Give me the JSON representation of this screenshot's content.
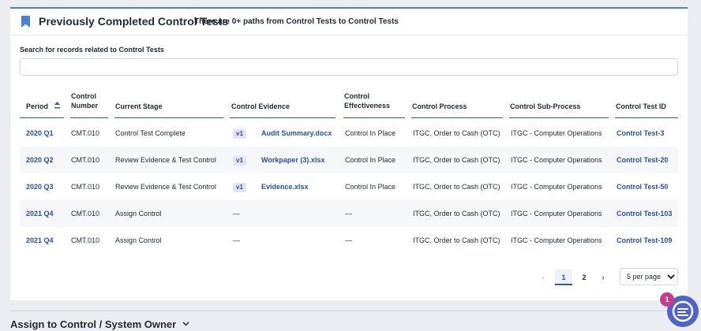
{
  "section": {
    "title": "Previously Completed Control Tests",
    "subtitle": "There are 0+ paths from Control Tests to Control Tests",
    "search_label": "Search for records related to Control Tests",
    "search_value": ""
  },
  "table": {
    "columns": {
      "period": "Period",
      "control_number_1": "Control",
      "control_number_2": "Number",
      "current_stage": "Current Stage",
      "control_evidence": "Control Evidence",
      "control_effectiveness_1": "Control",
      "control_effectiveness_2": "Effectiveness",
      "control_process": "Control Process",
      "control_sub_process": "Control Sub-Process",
      "control_test_id": "Control Test ID"
    },
    "rows": [
      {
        "period": "2020 Q1",
        "number": "CMT.010",
        "stage": "Control Test Complete",
        "version": "v1",
        "evidence": "Audit Summary.docx",
        "effectiveness": "Control In Place",
        "process": "ITGC, Order to Cash (OTC)",
        "sub_process": "ITGC - Computer Operations",
        "test_id": "Control Test-3"
      },
      {
        "period": "2020 Q2",
        "number": "CMT.010",
        "stage": "Review Evidence & Test Control",
        "version": "v1",
        "evidence": "Workpaper (3).xlsx",
        "effectiveness": "Control In Place",
        "process": "ITGC, Order to Cash (OTC)",
        "sub_process": "ITGC - Computer Operations",
        "test_id": "Control Test-20"
      },
      {
        "period": "2020 Q3",
        "number": "CMT.010",
        "stage": "Review Evidence & Test Control",
        "version": "v1",
        "evidence": "Evidence.xlsx",
        "effectiveness": "Control In Place",
        "process": "ITGC, Order to Cash (OTC)",
        "sub_process": "ITGC - Computer Operations",
        "test_id": "Control Test-50"
      },
      {
        "period": "2021 Q4",
        "number": "CMT.010",
        "stage": "Assign Control",
        "version": "",
        "evidence": "—",
        "effectiveness": "—",
        "process": "ITGC, Order to Cash (OTC)",
        "sub_process": "ITGC - Computer Operations",
        "test_id": "Control Test-103"
      },
      {
        "period": "2021 Q4",
        "number": "CMT.010",
        "stage": "Assign Control",
        "version": "",
        "evidence": "—",
        "effectiveness": "—",
        "process": "ITGC, Order to Cash (OTC)",
        "sub_process": "ITGC - Computer Operations",
        "test_id": "Control Test-109"
      }
    ]
  },
  "pagination": {
    "prev": "‹",
    "page_1": "1",
    "page_2": "2",
    "next": "›",
    "per_page": "5 per page",
    "per_page_options": [
      "5 per page"
    ]
  },
  "next_section": {
    "title": "Assign to Control / System Owner"
  },
  "chat": {
    "badge_count": "1"
  },
  "colors": {
    "accent": "#4a7fd4",
    "link": "#2a4fa8",
    "chat": "#4f63c8",
    "badge": "#c73c8f"
  },
  "icons": {
    "bookmark": "bookmark-icon",
    "sort": "sort-icon",
    "chevron": "chevron-down-icon",
    "chat": "chat-logo-icon"
  }
}
